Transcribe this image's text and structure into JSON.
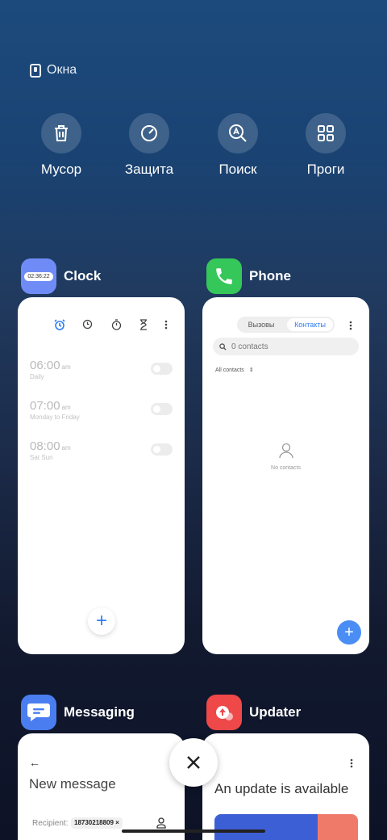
{
  "header": {
    "windows_label": "Окна"
  },
  "quick_actions": [
    {
      "label": "Мусор",
      "icon": "trash-icon"
    },
    {
      "label": "Защита",
      "icon": "shield-gauge-icon"
    },
    {
      "label": "Поиск",
      "icon": "search-icon"
    },
    {
      "label": "Проги",
      "icon": "apps-grid-icon"
    }
  ],
  "apps": {
    "clock": {
      "name": "Clock",
      "icon_time": "02:36:22",
      "icon_color": "#6f8cf6",
      "alarms": [
        {
          "time": "06:00",
          "ampm": "am",
          "repeat": "Daily"
        },
        {
          "time": "07:00",
          "ampm": "am",
          "repeat": "Monday to Friday"
        },
        {
          "time": "08:00",
          "ampm": "am",
          "repeat": "Sat Sun"
        }
      ],
      "add_label": "+"
    },
    "phone": {
      "name": "Phone",
      "icon_color": "#35c759",
      "tabs": [
        "Вызовы",
        "Контакты"
      ],
      "search_placeholder": "0 contacts",
      "filter_label": "All contacts",
      "empty_text": "No contacts",
      "add_label": "+"
    },
    "messaging": {
      "name": "Messaging",
      "icon_color": "#4a7df0",
      "title": "New message",
      "recipient_label": "Recipient:",
      "recipient_chip": "18730218809 ×"
    },
    "updater": {
      "name": "Updater",
      "icon_color": "#ee4848",
      "title": "An update is available"
    }
  },
  "accent_color": "#2f7df6"
}
